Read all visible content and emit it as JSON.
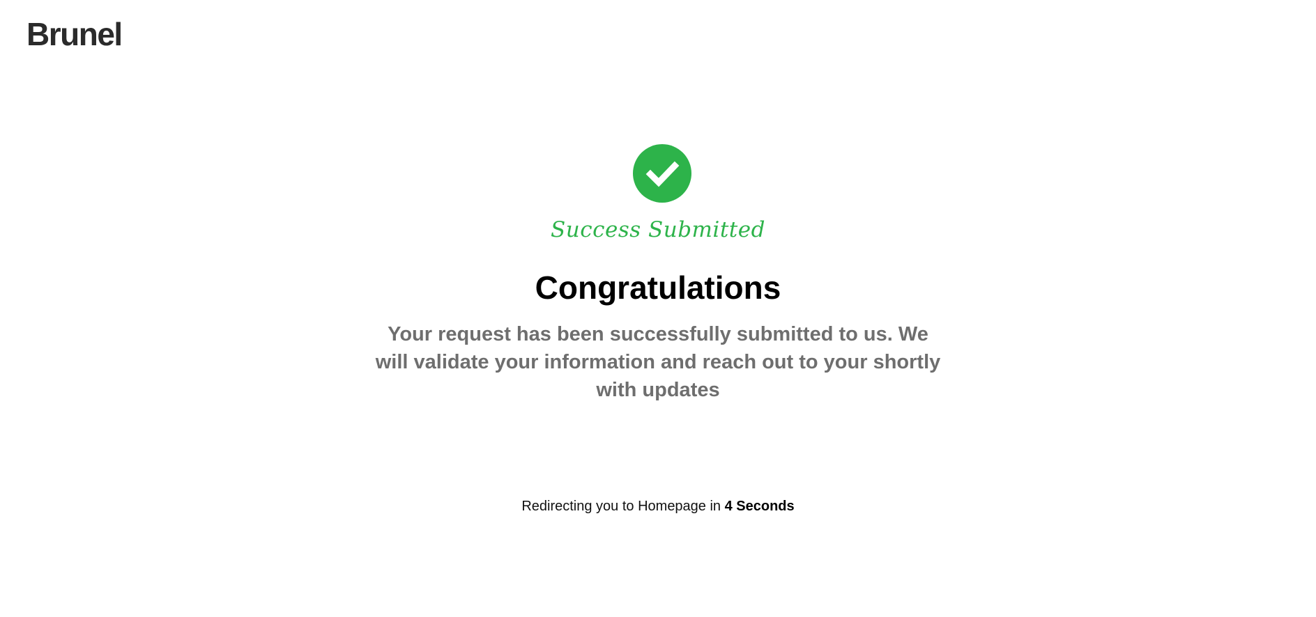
{
  "brand": {
    "logo_text": "Brunel"
  },
  "status": {
    "icon": "checkmark-circle-icon",
    "label": "Success Submitted",
    "accent_color": "#2db34a"
  },
  "content": {
    "headline": "Congratulations",
    "message": "Your request has been successfully submitted to us. We will validate your information and reach out to your shortly with updates"
  },
  "redirect": {
    "prefix": "Redirecting you to Homepage in ",
    "countdown": "4 Seconds"
  }
}
